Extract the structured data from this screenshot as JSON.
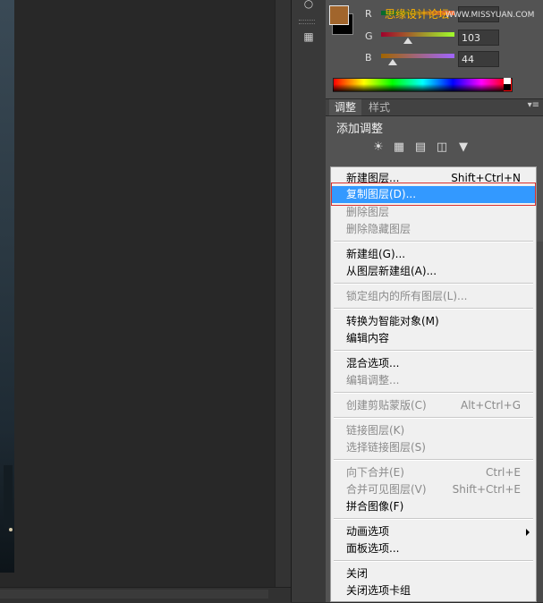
{
  "watermark": {
    "text": "思缘设计论坛",
    "url": "WWW.MISSYUAN.COM"
  },
  "color_panel": {
    "foreground_color": "#a1652c",
    "background_color": "#000000",
    "channels": [
      {
        "label": "R",
        "value": ""
      },
      {
        "label": "G",
        "value": "103"
      },
      {
        "label": "B",
        "value": "44"
      }
    ]
  },
  "adjustments_panel": {
    "tabs": [
      "调整",
      "样式"
    ],
    "title": "添加调整",
    "icons": [
      "brightness-icon",
      "levels-icon",
      "curves-icon",
      "exposure-icon",
      "triangle-icon"
    ]
  },
  "context_menu": {
    "items": [
      {
        "label": "新建图层...",
        "shortcut": "Shift+Ctrl+N",
        "state": "enabled"
      },
      {
        "label": "复制图层(D)...",
        "shortcut": "",
        "state": "highlighted"
      },
      {
        "label": "删除图层",
        "shortcut": "",
        "state": "disabled"
      },
      {
        "label": "删除隐藏图层",
        "shortcut": "",
        "state": "disabled"
      },
      {
        "label": "新建组(G)...",
        "shortcut": "",
        "state": "enabled"
      },
      {
        "label": "从图层新建组(A)...",
        "shortcut": "",
        "state": "enabled"
      },
      {
        "label": "锁定组内的所有图层(L)...",
        "shortcut": "",
        "state": "disabled"
      },
      {
        "label": "转换为智能对象(M)",
        "shortcut": "",
        "state": "enabled"
      },
      {
        "label": "编辑内容",
        "shortcut": "",
        "state": "enabled"
      },
      {
        "label": "混合选项...",
        "shortcut": "",
        "state": "enabled"
      },
      {
        "label": "编辑调整...",
        "shortcut": "",
        "state": "disabled"
      },
      {
        "label": "创建剪贴蒙版(C)",
        "shortcut": "Alt+Ctrl+G",
        "state": "disabled"
      },
      {
        "label": "链接图层(K)",
        "shortcut": "",
        "state": "disabled"
      },
      {
        "label": "选择链接图层(S)",
        "shortcut": "",
        "state": "disabled"
      },
      {
        "label": "向下合并(E)",
        "shortcut": "Ctrl+E",
        "state": "disabled"
      },
      {
        "label": "合并可见图层(V)",
        "shortcut": "Shift+Ctrl+E",
        "state": "disabled"
      },
      {
        "label": "拼合图像(F)",
        "shortcut": "",
        "state": "enabled"
      },
      {
        "label": "动画选项",
        "shortcut": "",
        "state": "enabled",
        "submenu": true
      },
      {
        "label": "面板选项...",
        "shortcut": "",
        "state": "enabled"
      },
      {
        "label": "关闭",
        "shortcut": "",
        "state": "enabled"
      },
      {
        "label": "关闭选项卡组",
        "shortcut": "",
        "state": "enabled"
      }
    ]
  }
}
